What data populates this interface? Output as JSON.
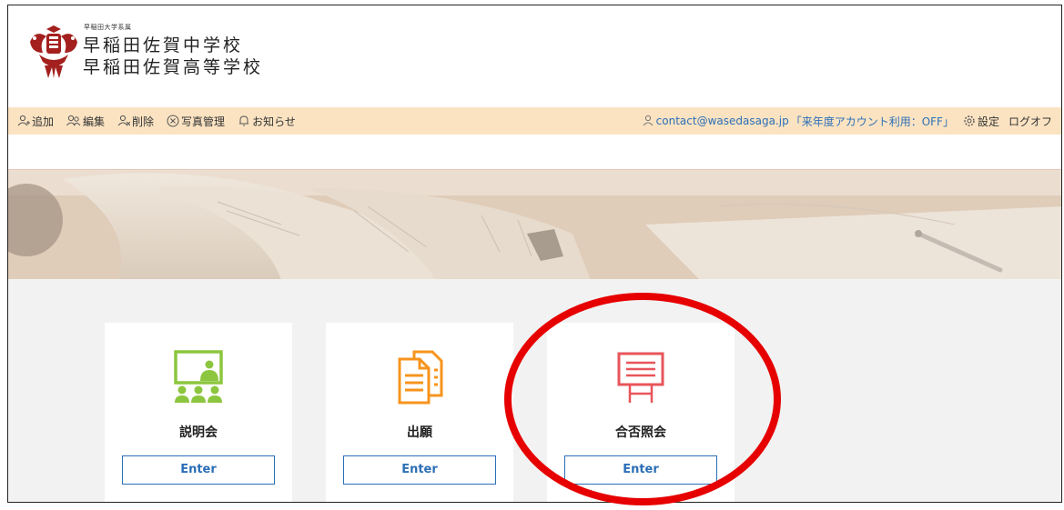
{
  "header": {
    "university_line": "早稲田大学系属",
    "school_junior": "早稲田佐賀中学校",
    "school_senior": "早稲田佐賀高等学校"
  },
  "nav": {
    "left_items": [
      {
        "label": "追加",
        "icon": "user-add-icon"
      },
      {
        "label": "編集",
        "icon": "user-edit-icon"
      },
      {
        "label": "削除",
        "icon": "user-delete-icon"
      },
      {
        "label": "写真管理",
        "icon": "photo-manage-icon"
      },
      {
        "label": "お知らせ",
        "icon": "bell-icon"
      }
    ],
    "email": "contact@wasedasaga.jp",
    "account_status": "「来年度アカウント利用：OFF」",
    "settings_label": "設定",
    "logout_label": "ログオフ"
  },
  "cards": [
    {
      "title": "説明会",
      "button": "Enter",
      "icon": "seminar-icon",
      "color": "#8cc63f"
    },
    {
      "title": "出願",
      "button": "Enter",
      "icon": "documents-icon",
      "color": "#f7941d"
    },
    {
      "title": "合否照会",
      "button": "Enter",
      "icon": "board-icon",
      "color": "#e8555a"
    }
  ],
  "colors": {
    "nav_bg": "#fbe3c2",
    "accent_blue": "#2b6fb6",
    "annotation_red": "#e60000"
  }
}
